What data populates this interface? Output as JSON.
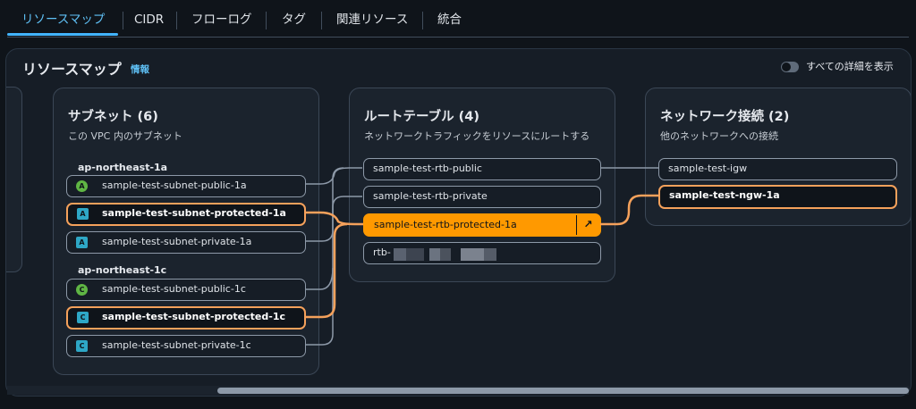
{
  "tabs": [
    {
      "label": "リソースマップ",
      "active": true
    },
    {
      "label": "CIDR"
    },
    {
      "label": "フローログ"
    },
    {
      "label": "タグ"
    },
    {
      "label": "関連リソース"
    },
    {
      "label": "統合"
    }
  ],
  "resource_map": {
    "title": "リソースマップ",
    "info_label": "情報",
    "toggle_label": "すべての詳細を表示",
    "toggle_on": false
  },
  "subnets": {
    "title": "サブネット (6)",
    "subtitle": "この VPC 内のサブネット",
    "groups": [
      {
        "az": "ap-northeast-1a",
        "items": [
          {
            "label": "sample-test-subnet-public-1a",
            "badge": "A",
            "type": "public"
          },
          {
            "label": "sample-test-subnet-protected-1a",
            "badge": "A",
            "type": "protected",
            "highlighted": true
          },
          {
            "label": "sample-test-subnet-private-1a",
            "badge": "A",
            "type": "protected"
          }
        ]
      },
      {
        "az": "ap-northeast-1c",
        "items": [
          {
            "label": "sample-test-subnet-public-1c",
            "badge": "C",
            "type": "public"
          },
          {
            "label": "sample-test-subnet-protected-1c",
            "badge": "C",
            "type": "protected",
            "highlighted": true
          },
          {
            "label": "sample-test-subnet-private-1c",
            "badge": "C",
            "type": "protected"
          }
        ]
      }
    ]
  },
  "route_tables": {
    "title": "ルートテーブル (4)",
    "subtitle": "ネットワークトラフィックをリソースにルートする",
    "items": [
      {
        "label": "sample-test-rtb-public"
      },
      {
        "label": "sample-test-rtb-private"
      },
      {
        "label": "sample-test-rtb-protected-1a",
        "selected": true,
        "action_icon": "external-link-icon"
      },
      {
        "label": "rtb-",
        "redacted": true
      }
    ]
  },
  "network_connections": {
    "title": "ネットワーク接続 (2)",
    "subtitle": "他のネットワークへの接続",
    "items": [
      {
        "label": "sample-test-igw"
      },
      {
        "label": "sample-test-ngw-1a",
        "highlighted": true
      }
    ]
  },
  "colors": {
    "accent": "#42b4ff",
    "highlight_border": "#f5a15b",
    "selected_fill": "#ff9900",
    "public_badge": "#5fb544",
    "protected_badge": "#2ea7c6"
  }
}
